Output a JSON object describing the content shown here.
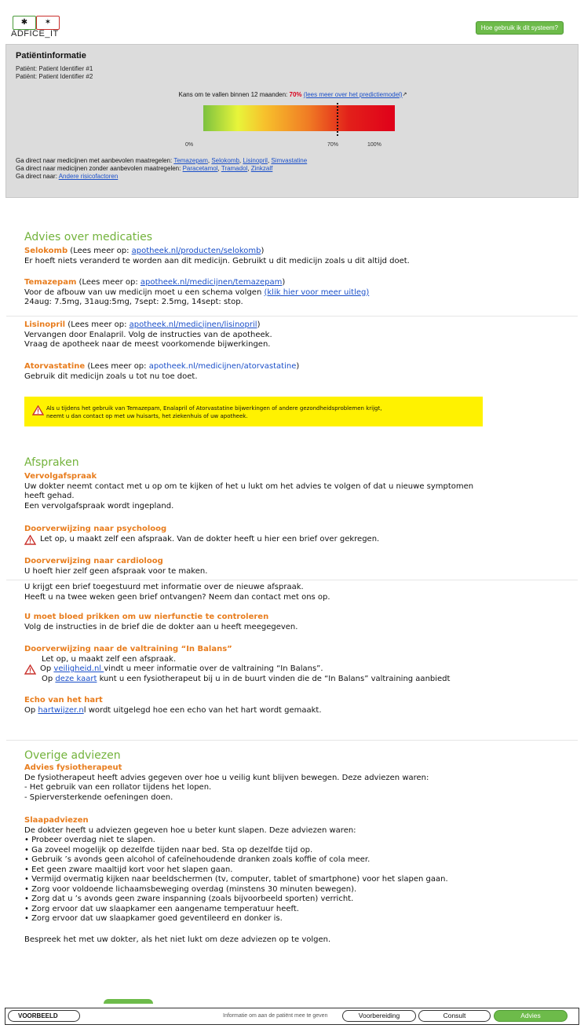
{
  "app": {
    "logo_text": "ADFICE_IT",
    "help_button": "Hoe gebruik ik dit systeem?"
  },
  "patient": {
    "title": "Patiëntinformatie",
    "line1": "Patiënt: Patient Identifier #1",
    "line2": "Patiënt: Patient Identifier #2",
    "risk_prefix": "Kans om te vallen binnen 12 maanden: ",
    "risk_value": "70%",
    "risk_link": "(lees meer over het predictiemodel)",
    "risk_fraction": 0.7,
    "tick_0": "0%",
    "tick_70": "70%",
    "tick_100": "100%",
    "goto_with_prefix": "Ga direct naar medicijnen met aanbevolen maatregelen: ",
    "goto_with": [
      "Temazepam",
      "Selokomb",
      "Lisinopril",
      "Simvastatine"
    ],
    "goto_without_prefix": "Ga direct naar medicijnen zonder aanbevolen maatregelen: ",
    "goto_without": [
      "Paracetamol",
      "Tramadol",
      "Zinkzalf"
    ],
    "goto_other_prefix": "Ga direct naar: ",
    "goto_other": "Andere risicofactoren"
  },
  "medications": {
    "heading": "Advies over medicaties",
    "lees": " (Lees meer op: ",
    "close": ")",
    "selokomb": {
      "name": "Selokomb",
      "link": "apotheek.nl/producten/selokomb",
      "text": "Er hoeft niets veranderd te worden aan dit medicijn. Gebruikt u dit medicijn zoals u dit altijd doet."
    },
    "temazepam": {
      "name": "Temazepam",
      "link": "apotheek.nl/medicijnen/temazepam",
      "text1": "Voor de afbouw van uw medicijn moet u een schema volgen ",
      "text1_link": "(klik hier voor meer uitleg)",
      "text2": "24aug: 7.5mg, 31aug:5mg, 7sept: 2.5mg, 14sept: stop."
    },
    "lisinopril": {
      "name": "Lisinopril",
      "link": "apotheek.nl/medicijnen/lisinopril",
      "text1": "Vervangen door Enalapril. Volg de instructies van de apotheek.",
      "text2": "Vraag de apotheek naar de meest voorkomende bijwerkingen."
    },
    "atorvastatine": {
      "name": "Atorvastatine",
      "link": "apotheek.nl/medicijnen/atorvastatine",
      "text": "Gebruik dit medicijn zoals u tot nu toe doet."
    },
    "warning1": "Als u tijdens het gebruik van Temazepam, Enalapril of Atorvastatine bijwerkingen of andere gezondheidsproblemen krijgt,",
    "warning2": "neemt u dan contact op met uw huisarts, het ziekenhuis of uw apotheek."
  },
  "appointments": {
    "heading": "Afspraken",
    "follow": {
      "title": "Vervolgafspraak",
      "text1": "Uw dokter neemt contact met u op om te kijken of het u lukt om het advies te volgen of dat u nieuwe symptomen",
      "text2": "heeft gehad.",
      "text3": "Een vervolgafspraak wordt ingepland."
    },
    "psych": {
      "title": "Doorverwijzing naar psycholoog",
      "text": "Let op, u maakt zelf een afspraak. Van de dokter heeft u hier een brief over gekregen."
    },
    "cardio": {
      "title": "Doorverwijzing naar cardioloog",
      "text1": "U hoeft hier zelf geen afspraak voor te maken.",
      "text2": "U krijgt een brief toegestuurd met informatie over de nieuwe afspraak.",
      "text3": "Heeft u na twee weken geen brief ontvangen? Neem dan contact met ons op."
    },
    "blood": {
      "title": "U moet bloed prikken om uw nierfunctie te controleren",
      "text": "Volg de instructies in de brief die de dokter aan u heeft meegegeven."
    },
    "balans": {
      "title": "Doorverwijzing naar de valtraining “In Balans”",
      "text1": "Let op, u maakt zelf een afspraak.",
      "text2_a": "Op ",
      "text2_link": "veiligheid.nl ",
      "text2_b": "vindt u meer informatie over de valtraining “In Balans”.",
      "text3_a": "Op ",
      "text3_link": "deze kaart",
      "text3_b": " kunt u een fysiotherapeut bij u in de buurt vinden die de “In Balans” valtraining aanbiedt"
    },
    "echo": {
      "title": "Echo van het hart",
      "text_a": "Op ",
      "text_link": "hartwijzer.n",
      "text_b": "l wordt uitgelegd hoe een echo van het hart wordt gemaakt."
    }
  },
  "other": {
    "heading": "Overige adviezen",
    "fysio": {
      "title": "Advies fysiotherapeut",
      "intro": "De fysiotherapeut heeft advies gegeven over hoe u veilig kunt blijven bewegen. Deze adviezen waren:",
      "items": [
        "-  Het gebruik van een rollator tijdens het lopen.",
        "-  Spierversterkende oefeningen doen."
      ]
    },
    "sleep": {
      "title": "Slaapadviezen",
      "intro": "De dokter heeft u adviezen gegeven hoe u beter kunt slapen. Deze adviezen waren:",
      "items": [
        "• Probeer overdag niet te slapen.",
        "• Ga zoveel mogelijk op dezelfde tijden naar bed. Sta op dezelfde tijd op.",
        "• Gebruik ’s avonds geen alcohol of cafeïnehoudende dranken zoals koffie of cola meer.",
        "• Eet geen zware maaltijd kort voor het slapen gaan.",
        "• Vermijd overmatig kijken naar beeldschermen (tv, computer, tablet of smartphone) voor het slapen gaan.",
        "• Zorg voor voldoende lichaamsbeweging overdag (minstens 30 minuten bewegen).",
        "• Zorg dat u ’s avonds geen zware inspanning (zoals bijvoorbeeld sporten) verricht.",
        "• Zorg ervoor dat uw slaapkamer een aangename temperatuur heeft.",
        "• Zorg ervoor dat uw slaapkamer goed geventileerd en donker is."
      ],
      "outro": "Bespreek het met uw dokter, als het niet lukt om deze adviezen op te volgen."
    }
  },
  "footer": {
    "badge": "VOORBEELD",
    "info": "Informatie om aan de patiënt mee te geven",
    "tabs": [
      "Voorbereiding",
      "Consult",
      "Advies"
    ],
    "active_tab": "Advies"
  }
}
